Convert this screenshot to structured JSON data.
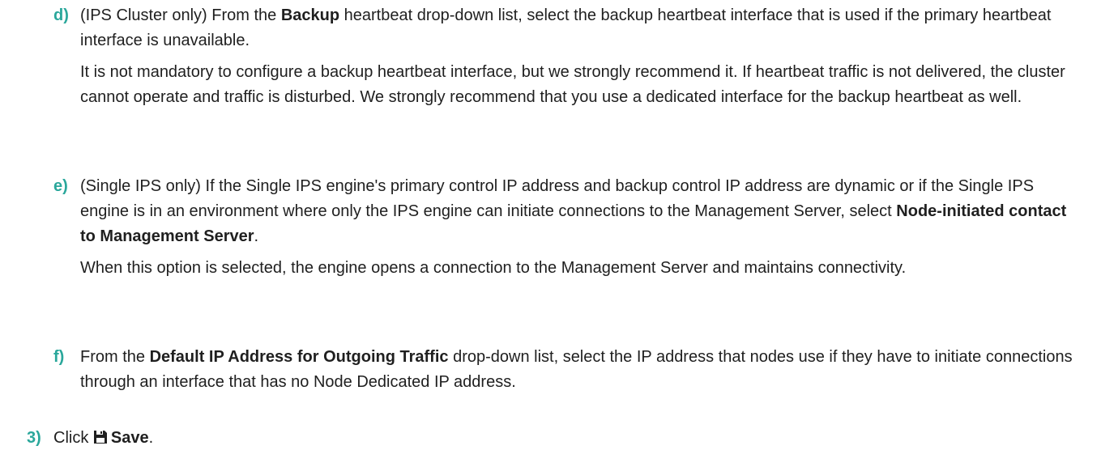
{
  "substeps": {
    "d": {
      "marker": "d)",
      "p1": {
        "pre": "(IPS Cluster only) From the ",
        "bold": "Backup",
        "post": " heartbeat drop-down list, select the backup heartbeat interface that is used if the primary heartbeat interface is unavailable."
      },
      "p2": "It is not mandatory to configure a backup heartbeat interface, but we strongly recommend it. If heartbeat traffic is not delivered, the cluster cannot operate and traffic is disturbed. We strongly recommend that you use a dedicated interface for the backup heartbeat as well."
    },
    "e": {
      "marker": "e)",
      "p1": {
        "pre": "(Single IPS only) If the Single IPS engine's primary control IP address and backup control IP address are dynamic or if the Single IPS engine is in an environment where only the IPS engine can initiate connections to the Management Server, select ",
        "bold": "Node-initiated contact to Management Server",
        "post": "."
      },
      "p2": "When this option is selected, the engine opens a connection to the Management Server and maintains connectivity."
    },
    "f": {
      "marker": "f)",
      "p1": {
        "pre": "From the ",
        "bold": "Default IP Address for Outgoing Traffic",
        "post": " drop-down list, select the IP address that nodes use if they have to initiate connections through an interface that has no Node Dedicated IP address."
      }
    }
  },
  "step3": {
    "marker": "3)",
    "pre": "Click ",
    "icon": "save-icon",
    "bold": "Save",
    "post": "."
  },
  "colors": {
    "marker": "#2aa79b",
    "text": "#1f1f1f"
  }
}
